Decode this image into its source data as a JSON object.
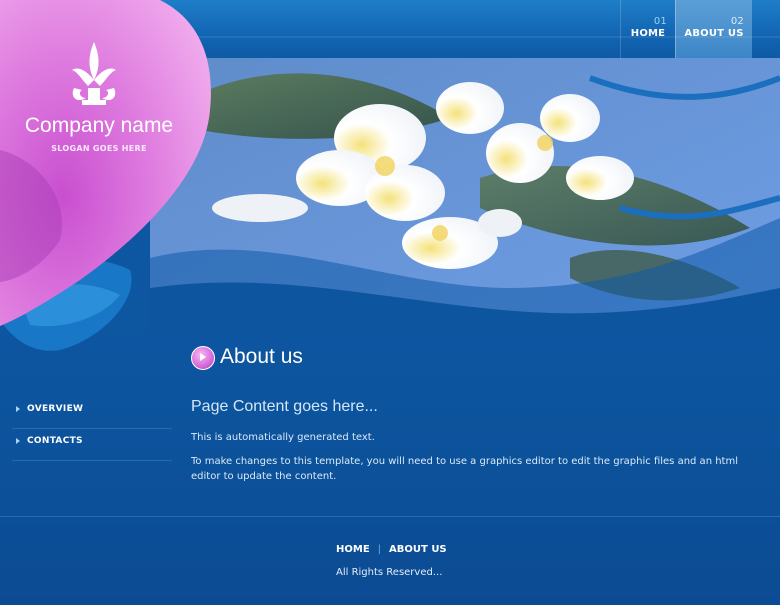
{
  "brand": {
    "company_name": "Company name",
    "slogan": "SLOGAN GOES HERE",
    "logo_icon": "ornament-lotus-icon"
  },
  "nav": {
    "items": [
      {
        "num": "01",
        "label": "HOME",
        "active": false
      },
      {
        "num": "02",
        "label": "ABOUT US",
        "active": true
      }
    ]
  },
  "sidebar": {
    "items": [
      {
        "label": "OVERVIEW"
      },
      {
        "label": "CONTACTS"
      }
    ]
  },
  "main": {
    "title": "About us",
    "heading": "Page Content goes here...",
    "paragraphs": [
      "This is automatically generated text.",
      "To make changes to this template, you will need to use a graphics editor to edit the graphic files and an html editor to update the content."
    ]
  },
  "footer": {
    "links": [
      "HOME",
      "ABOUT US"
    ],
    "separator": "|",
    "copyright": "All Rights Reserved..."
  },
  "colors": {
    "background": "#0d559f",
    "accent_pink": "#d66ad8",
    "active_tab": "#4a90cc"
  }
}
